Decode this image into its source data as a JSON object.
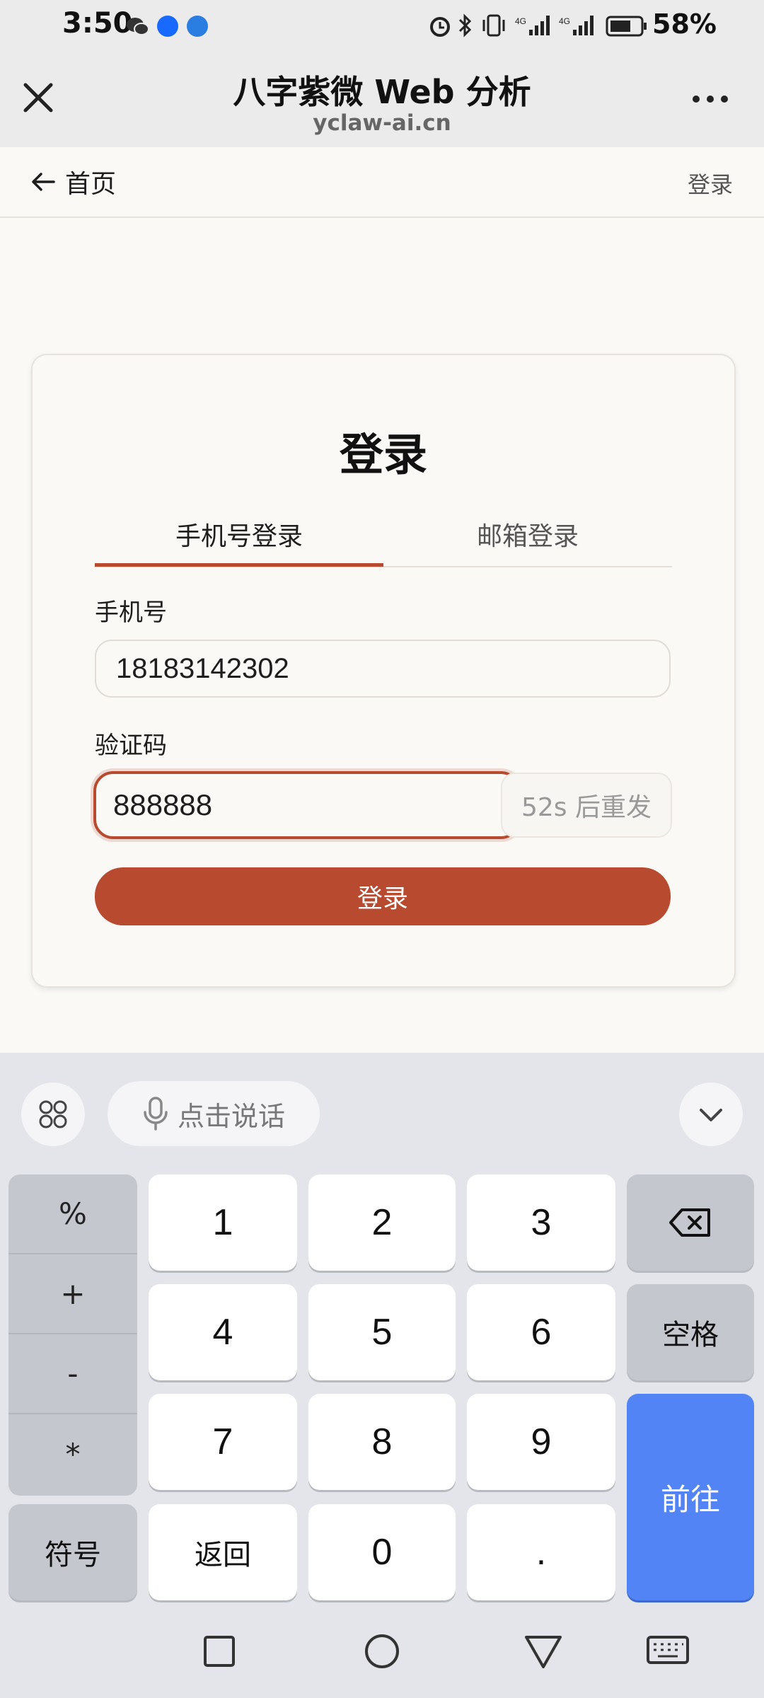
{
  "status_bar": {
    "time": "3:50",
    "battery": "58%"
  },
  "titlebar": {
    "title": "八字紫微 Web 分析",
    "domain": "yclaw-ai.cn"
  },
  "site_header": {
    "back_label": "首页",
    "login_link": "登录"
  },
  "login_card": {
    "title": "登录",
    "tabs": [
      "手机号登录",
      "邮箱登录"
    ],
    "phone_label": "手机号",
    "phone_value": "18183142302",
    "code_label": "验证码",
    "code_value": "888888",
    "resend_label": "52s 后重发",
    "submit_label": "登录"
  },
  "keyboard": {
    "voice_label": "点击说话",
    "symbols": [
      "%",
      "+",
      "-",
      "*"
    ],
    "symbols_key": "符号",
    "digits": [
      "1",
      "2",
      "3",
      "4",
      "5",
      "6",
      "7",
      "8",
      "9"
    ],
    "back_key": "返回",
    "zero_key": "0",
    "dot_key": ".",
    "space_key": "空格",
    "go_key": "前往"
  },
  "colors": {
    "accent": "#b84a30",
    "keyboard_go": "#5384f5"
  }
}
